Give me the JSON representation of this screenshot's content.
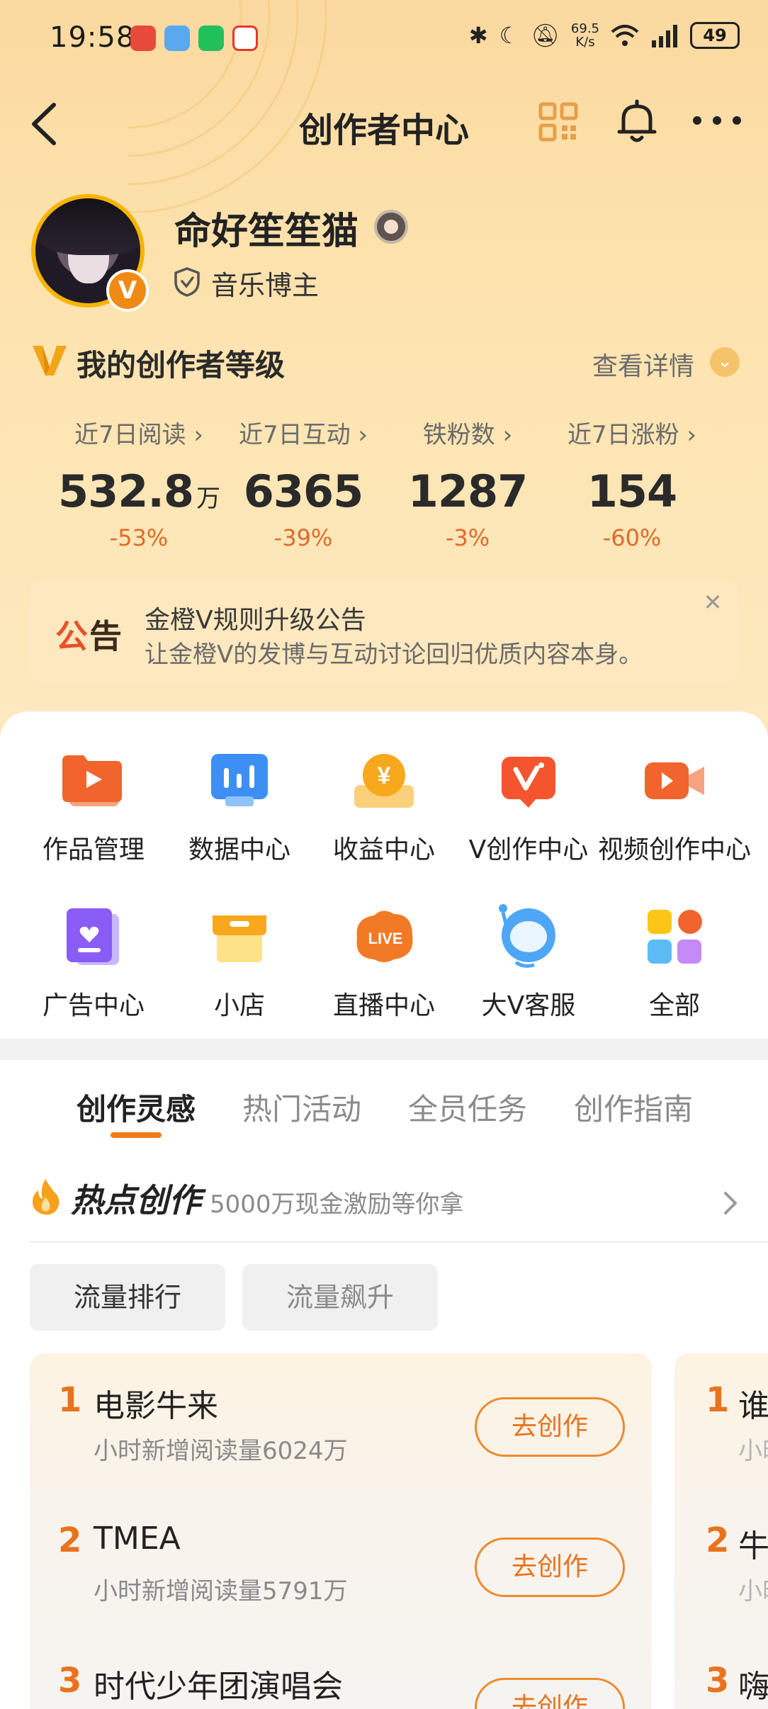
{
  "status_bar": {
    "time": "19:58",
    "net_speed_value": "69.5",
    "net_speed_unit": "K/s",
    "battery": "49"
  },
  "nav": {
    "title": "创作者中心"
  },
  "profile": {
    "name": "命好笙笙猫",
    "verified_badge": "V",
    "role": "音乐博主"
  },
  "level": {
    "title": "我的创作者等级",
    "detail_link": "查看详情"
  },
  "stats": [
    {
      "label": "近7日阅读",
      "value": "532.8",
      "unit": "万",
      "change": "-53%"
    },
    {
      "label": "近7日互动",
      "value": "6365",
      "unit": "",
      "change": "-39%"
    },
    {
      "label": "铁粉数",
      "value": "1287",
      "unit": "",
      "change": "-3%"
    },
    {
      "label": "近7日涨粉",
      "value": "154",
      "unit": "",
      "change": "-60%"
    }
  ],
  "notice": {
    "tag_a": "公",
    "tag_b": "告",
    "title": "金橙V规则升级公告",
    "subtitle": "让金橙V的发博与互动讨论回归优质内容本身。"
  },
  "grid": [
    {
      "label": "作品管理",
      "icon": "works-management-icon"
    },
    {
      "label": "数据中心",
      "icon": "data-center-icon"
    },
    {
      "label": "收益中心",
      "icon": "income-center-icon"
    },
    {
      "label": "V创作中心",
      "icon": "v-creation-icon"
    },
    {
      "label": "视频创作中心",
      "icon": "video-creation-icon"
    },
    {
      "label": "广告中心",
      "icon": "ad-center-icon"
    },
    {
      "label": "小店",
      "icon": "shop-icon"
    },
    {
      "label": "直播中心",
      "icon": "live-center-icon"
    },
    {
      "label": "大V客服",
      "icon": "customer-service-icon"
    },
    {
      "label": "全部",
      "icon": "all-apps-icon"
    }
  ],
  "live_icon_text": "LIVE",
  "income_icon_text": "¥",
  "tabs": [
    "创作灵感",
    "热门活动",
    "全员任务",
    "创作指南"
  ],
  "hot": {
    "title": "热点创作",
    "subtitle": "5000万现金激励等你拿"
  },
  "chips": [
    "流量排行",
    "流量飙升"
  ],
  "ranking": [
    {
      "rank": "1",
      "title": "电影牛来",
      "sub": "小时新增阅读量6024万",
      "button": "去创作"
    },
    {
      "rank": "2",
      "title": "TMEA",
      "sub": "小时新增阅读量5791万",
      "button": "去创作"
    },
    {
      "rank": "3",
      "title": "时代少年团演唱会",
      "sub": "",
      "button": "去创作"
    }
  ],
  "ranking2": [
    {
      "rank": "1",
      "title": "谁",
      "sub": "小时"
    },
    {
      "rank": "2",
      "title": "牛",
      "sub": "小时"
    },
    {
      "rank": "3",
      "title": "嗨",
      "sub": ""
    }
  ],
  "colors": {
    "accent": "#f07b18",
    "notice_tag": "#e8512a",
    "header_bg": "#fde2ad"
  }
}
